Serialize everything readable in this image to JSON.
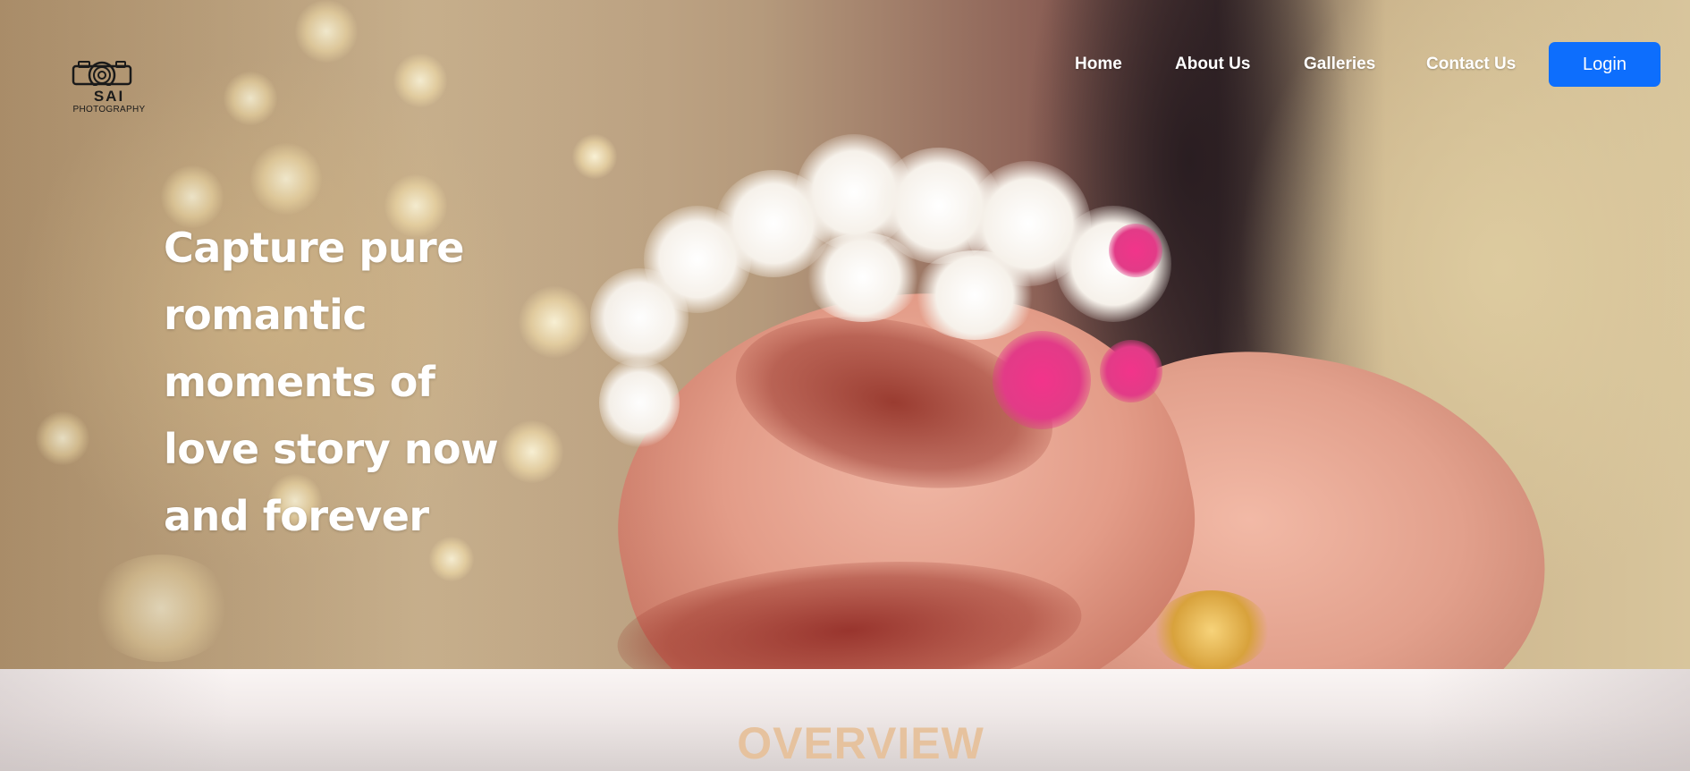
{
  "brand": {
    "name": "SAI",
    "subtitle": "PHOTOGRAPHY",
    "icon": "camera-logo-icon"
  },
  "nav": {
    "items": [
      {
        "label": "Home"
      },
      {
        "label": "About Us"
      },
      {
        "label": "Galleries"
      },
      {
        "label": "Contact Us"
      }
    ],
    "login_label": "Login"
  },
  "hero": {
    "tagline_lines": [
      "Capture pure",
      "romantic",
      "moments of",
      "love story now",
      "and forever"
    ],
    "background": "wedding-hands-mehndi-photo"
  },
  "overview": {
    "title": "OVERVIEW"
  },
  "colors": {
    "primary_button": "#0d6efd",
    "overview_title": "#e6c29e",
    "nav_text": "#ffffff"
  }
}
